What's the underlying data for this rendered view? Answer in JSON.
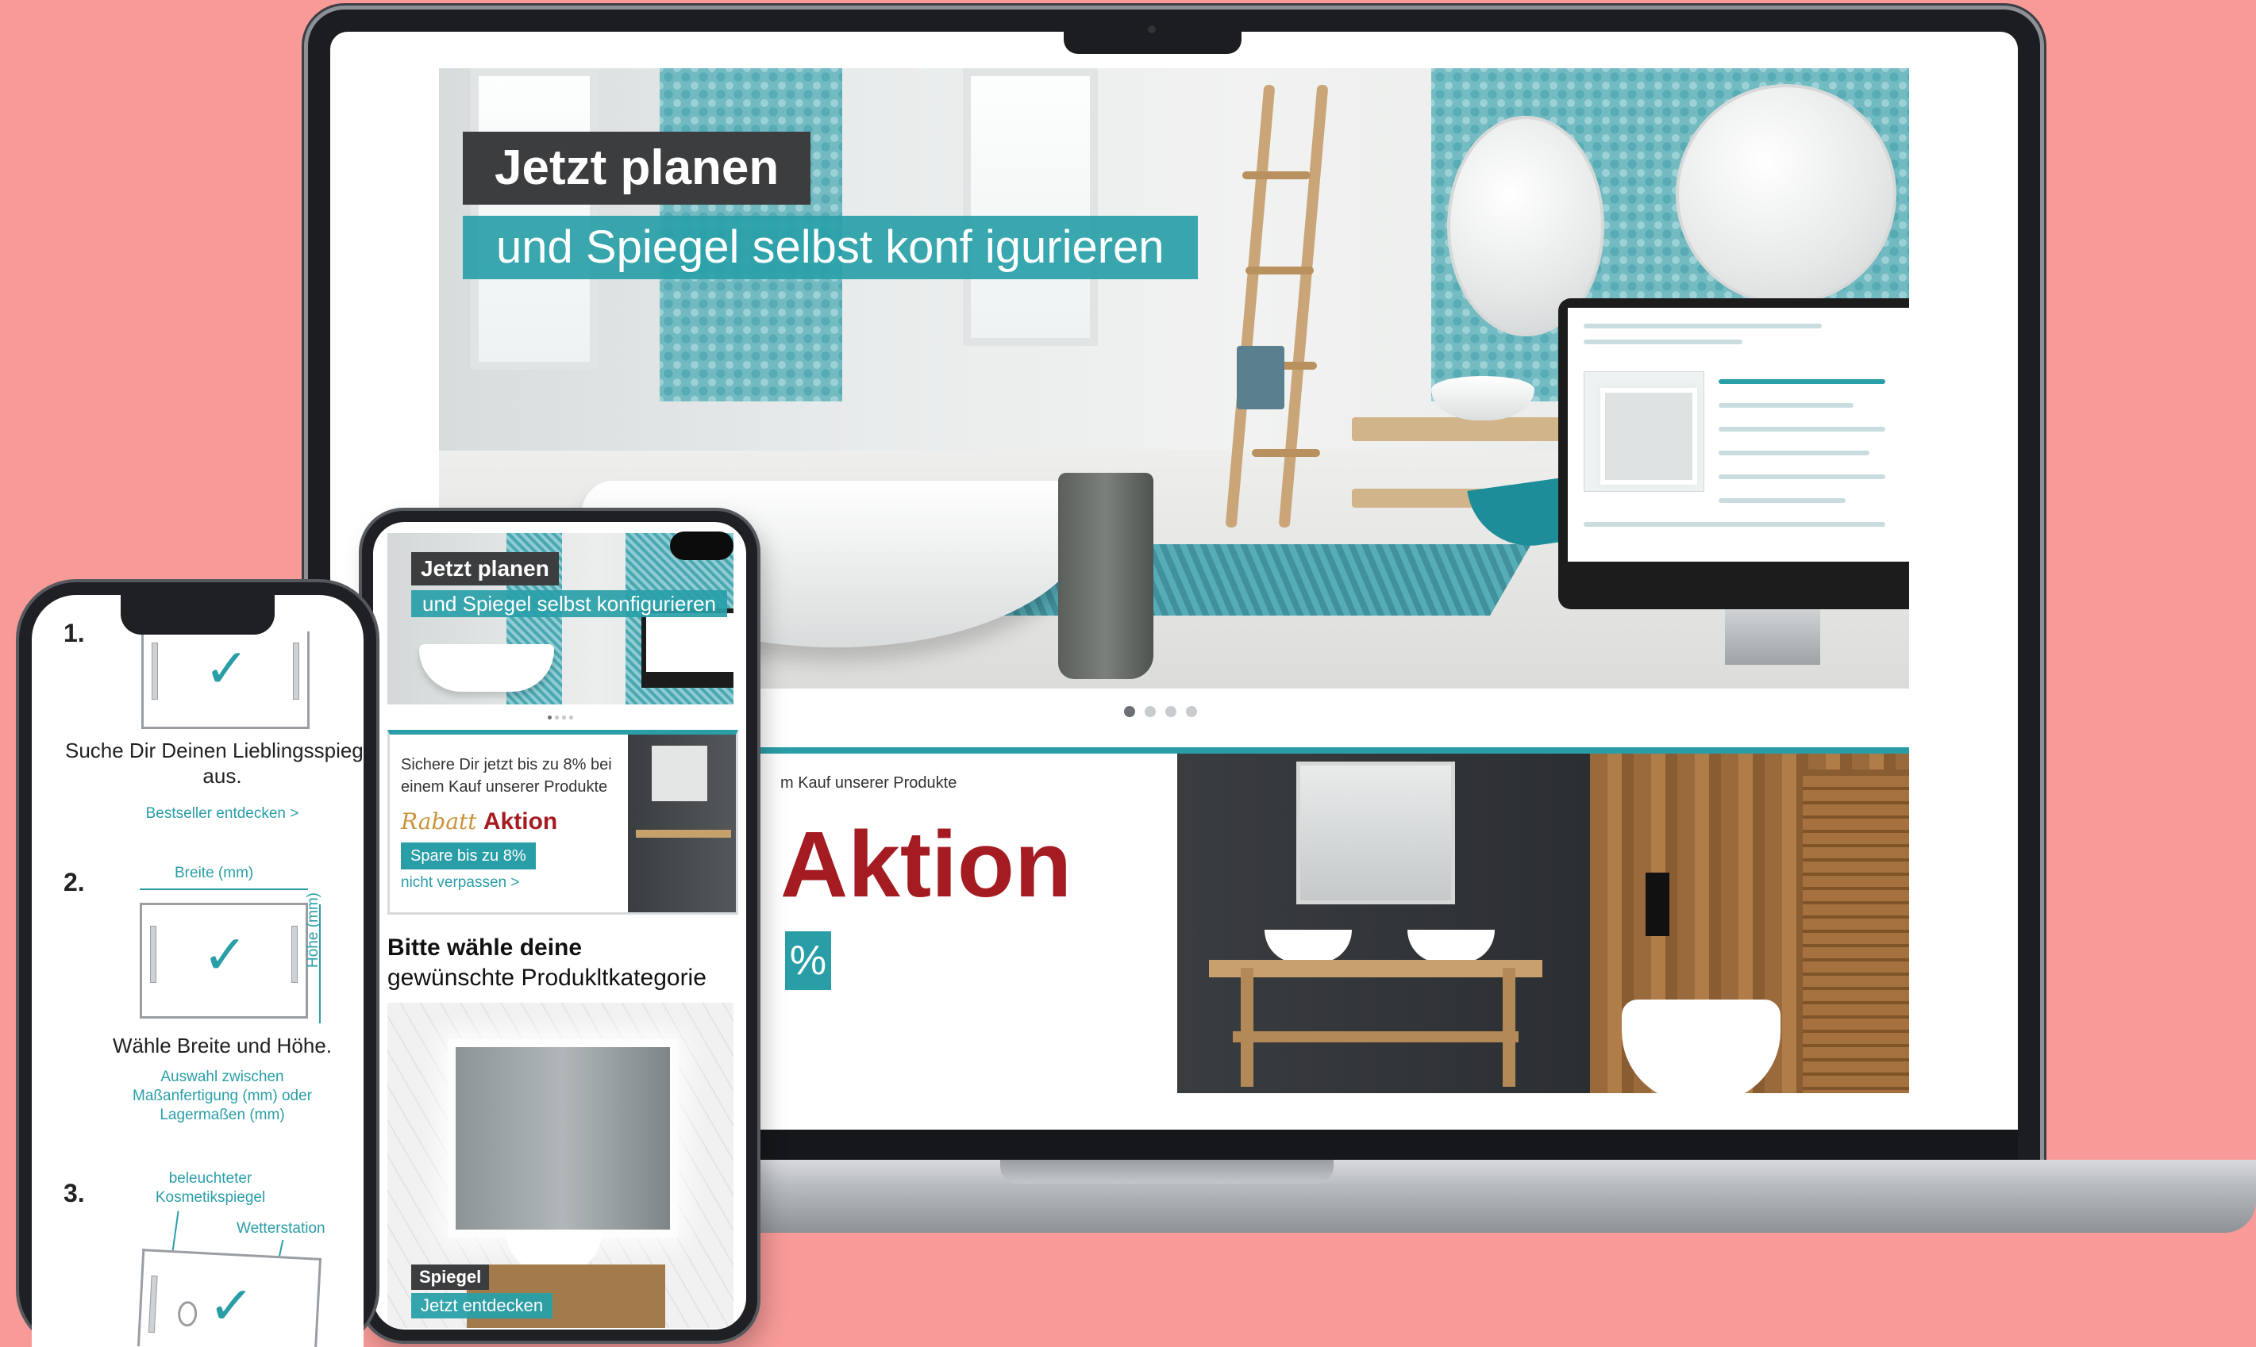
{
  "laptop": {
    "hero": {
      "title": "Jetzt planen",
      "subtitle": "und Spiegel selbst konf igurieren",
      "slide_count": 4,
      "active_slide": 1
    },
    "promo": {
      "small_text": "m Kauf unserer Produkte",
      "big_text": "Aktion",
      "badge_text": "%"
    }
  },
  "phone_middle": {
    "hero": {
      "title": "Jetzt planen",
      "subtitle": "und Spiegel selbst konfigurieren"
    },
    "promo": {
      "text": "Sichere Dir jetzt bis zu 8% bei einem Kauf unserer Produkte",
      "rabatt": "Rabatt",
      "aktion": "Aktion",
      "spare": "Spare bis zu 8%",
      "link": "nicht verpassen >"
    },
    "heading_bold": "Bitte wähle deine",
    "heading_rest": "gewünschte Produkltkategorie",
    "category": {
      "label": "Spiegel",
      "cta": "Jetzt entdecken"
    }
  },
  "phone_left": {
    "step1": {
      "number": "1.",
      "text": "Suche Dir Deinen Lieblingsspiegel aus.",
      "link": "Bestseller entdecken >"
    },
    "step2": {
      "number": "2.",
      "width_label": "Breite (mm)",
      "height_label": "Höhe (mm)",
      "text": "Wähle Breite und Höhe.",
      "hint": "Auswahl zwischen Maßanfertigung (mm) oder Lagermaßen (mm)"
    },
    "step3": {
      "number": "3.",
      "label_cosmetic": "beleuchteter Kosmetikspiegel",
      "label_weather": "Wetterstation"
    }
  },
  "colors": {
    "background": "#f79a98",
    "teal": "#2a9ea7",
    "dark_label": "#3b3d3f",
    "red": "#a41c22"
  }
}
